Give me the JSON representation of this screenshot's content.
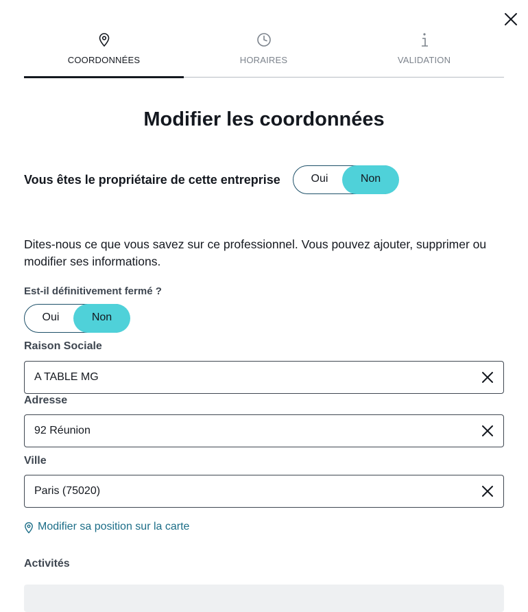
{
  "tabs": [
    {
      "label": "COORDONNÉES",
      "icon": "map-pin-icon",
      "active": true
    },
    {
      "label": "HORAIRES",
      "icon": "clock-icon",
      "active": false
    },
    {
      "label": "VALIDATION",
      "icon": "info-icon",
      "active": false
    }
  ],
  "title": "Modifier les coordonnées",
  "owner": {
    "question": "Vous êtes le propriétaire de cette entreprise",
    "yes": "Oui",
    "no": "Non",
    "selected": "Non"
  },
  "intro": "Dites-nous ce que vous savez sur ce professionnel. Vous pouvez ajouter, supprimer ou modifier ses informations.",
  "closed": {
    "question": "Est-il définitivement fermé ?",
    "yes": "Oui",
    "no": "Non",
    "selected": "Non"
  },
  "fields": {
    "company_label": "Raison Sociale",
    "company_value": "A TABLE MG",
    "address_label": "Adresse",
    "address_value": "92 Réunion",
    "city_label": "Ville",
    "city_value": "Paris (75020)"
  },
  "map_link": "Modifier sa position sur la carte",
  "activities_label": "Activités",
  "colors": {
    "accent": "#4fd1d9",
    "text": "#14181f",
    "link": "#1b6d87",
    "border": "#1c4f68"
  }
}
